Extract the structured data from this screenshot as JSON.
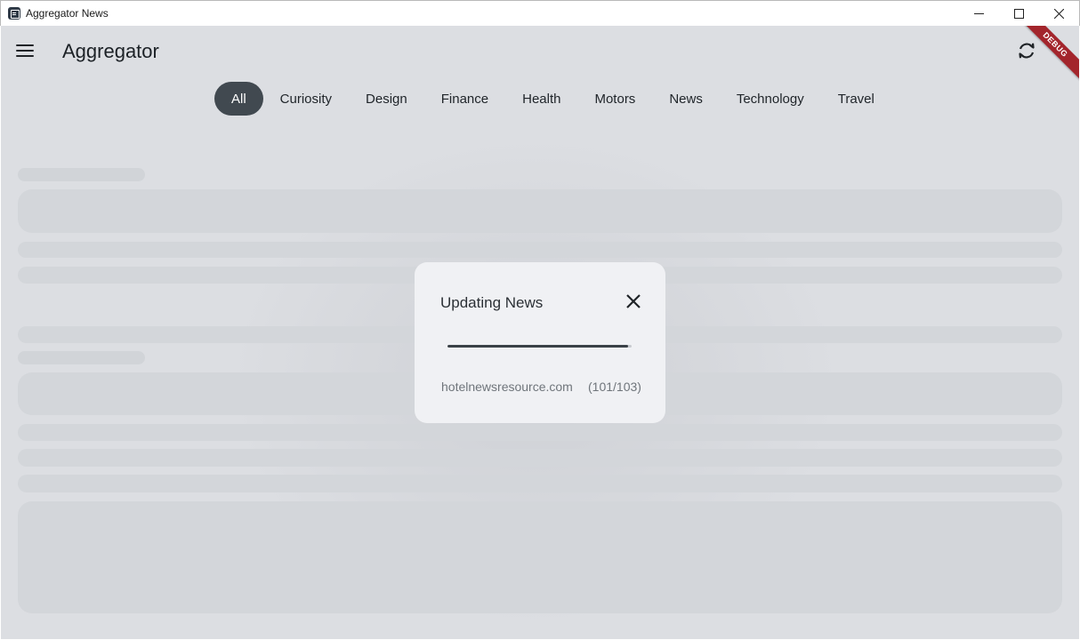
{
  "window": {
    "title": "Aggregator News",
    "controls": [
      "minimize-icon",
      "maximize-icon",
      "close-icon"
    ]
  },
  "app": {
    "title": "Aggregator",
    "debug_banner": "DEBUG",
    "icons": {
      "menu": "menu-icon",
      "refresh": "refresh-icon"
    }
  },
  "categories": {
    "active": "All",
    "items": [
      "All",
      "Curiosity",
      "Design",
      "Finance",
      "Health",
      "Motors",
      "News",
      "Technology",
      "Travel"
    ]
  },
  "dialog": {
    "title": "Updating News",
    "source": "hotelnewsresource.com",
    "count": "(101/103)",
    "progress": 0.9806
  },
  "colors": {
    "active_chip": "#414950",
    "debug_ribbon": "#a3252c",
    "background": "#dcdee2",
    "dialog": "#f0f1f4"
  }
}
